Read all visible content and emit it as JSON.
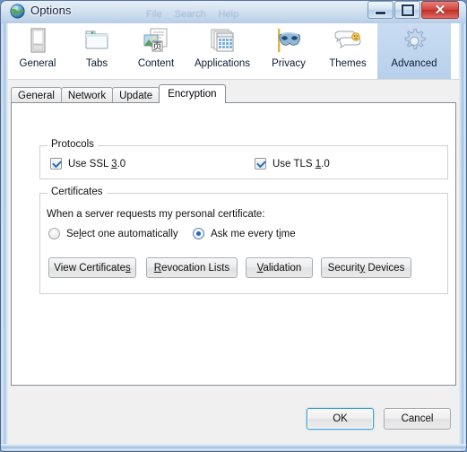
{
  "window": {
    "title": "Options",
    "app_icon": "globe-icon",
    "controls": {
      "minimize": "Minimize",
      "maximize": "Maximize",
      "close": "Close",
      "close_glyph": "✕"
    },
    "glass_ghost_text": [
      "File",
      "Search",
      "Help"
    ]
  },
  "toolbar": {
    "items": [
      {
        "label": "General",
        "icon": "general-icon",
        "selected": false
      },
      {
        "label": "Tabs",
        "icon": "tabs-icon",
        "selected": false
      },
      {
        "label": "Content",
        "icon": "content-icon",
        "selected": false
      },
      {
        "label": "Applications",
        "icon": "applications-icon",
        "selected": false
      },
      {
        "label": "Privacy",
        "icon": "privacy-mask-icon",
        "selected": false
      },
      {
        "label": "Themes",
        "icon": "themes-icon",
        "selected": false
      },
      {
        "label": "Advanced",
        "icon": "gear-icon",
        "selected": true
      }
    ],
    "selected_bg": "#c1d6ef"
  },
  "subtabs": {
    "items": [
      {
        "label": "General",
        "selected": false
      },
      {
        "label": "Network",
        "selected": false
      },
      {
        "label": "Update",
        "selected": false
      },
      {
        "label": "Encryption",
        "selected": true
      }
    ]
  },
  "protocols": {
    "title": "Protocols",
    "ssl": {
      "label_pre": "Use SSL ",
      "accel": "3",
      "label_post": ".0",
      "checked": true,
      "full_label": "Use SSL 3.0"
    },
    "tls": {
      "label_pre": "Use TLS ",
      "accel": "1",
      "label_post": ".0",
      "checked": true,
      "full_label": "Use TLS 1.0"
    }
  },
  "certificates": {
    "title": "Certificates",
    "note": "When a server requests my personal certificate:",
    "auto": {
      "label_pre": "Se",
      "accel": "l",
      "label_post": "ect one automatically",
      "checked": false,
      "full_label": "Select one automatically"
    },
    "ask": {
      "label_pre": "Ask me every t",
      "accel": "i",
      "label_post": "me",
      "checked": true,
      "full_label": "Ask me every time"
    },
    "buttons": [
      {
        "pre": "View Certificate",
        "accel": "s",
        "post": "",
        "full_label": "View Certificates"
      },
      {
        "pre": "",
        "accel": "R",
        "post": "evocation Lists",
        "full_label": "Revocation Lists"
      },
      {
        "pre": "",
        "accel": "V",
        "post": "alidation",
        "full_label": "Validation"
      },
      {
        "pre": "Securit",
        "accel": "y",
        "post": " Devices",
        "full_label": "Security Devices"
      }
    ]
  },
  "footer": {
    "ok_label": "OK",
    "cancel_label": "Cancel",
    "ok_focused": true
  },
  "colors": {
    "accent_blue": "#1f6fb8",
    "focus_ring": "#3c9cd6",
    "close_red": "#d2453c",
    "selected_tool_bg": "#c1d6ef",
    "panel_bg": "#ffffff",
    "dialog_bg": "#f0f0f0"
  }
}
